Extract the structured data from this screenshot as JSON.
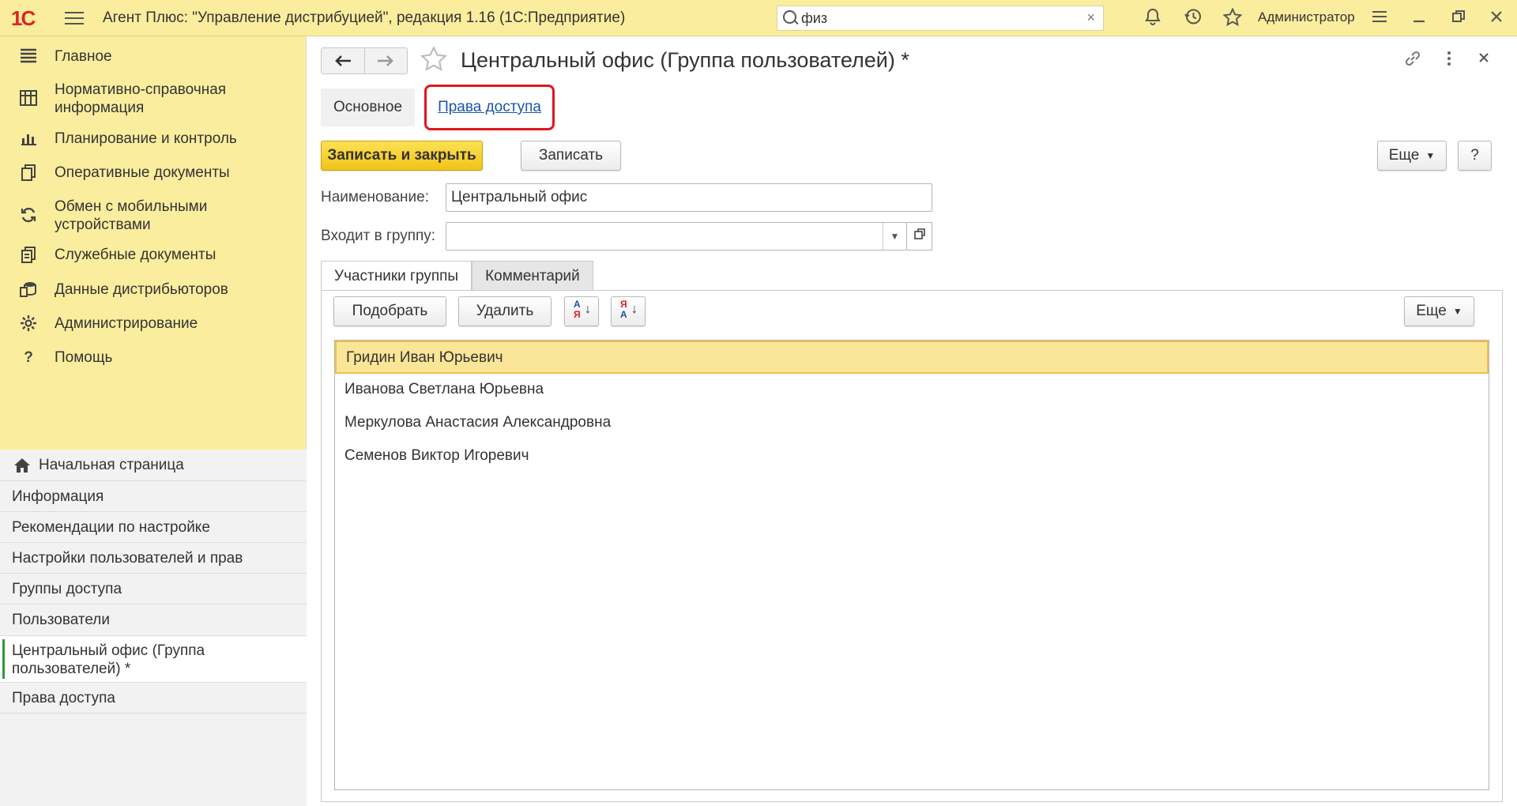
{
  "app": {
    "logo_text": "1С",
    "title": "Агент Плюс: \"Управление дистрибуцией\", редакция 1.16  (1С:Предприятие)",
    "search_value": "физ",
    "search_clear": "×",
    "user": "Администратор",
    "icons": [
      "bell-icon",
      "history-icon",
      "star-icon",
      "settings-icon",
      "minimize-icon",
      "restore-icon",
      "close-icon"
    ]
  },
  "sidebar": {
    "sections": [
      {
        "label": "Главное",
        "icon": "menu-list-icon"
      },
      {
        "label": "Нормативно-справочная информация",
        "icon": "catalog-icon"
      },
      {
        "label": "Планирование и контроль",
        "icon": "chart-icon"
      },
      {
        "label": "Оперативные документы",
        "icon": "documents-icon"
      },
      {
        "label": "Обмен с мобильными устройствами",
        "icon": "sync-icon"
      },
      {
        "label": "Служебные документы",
        "icon": "service-docs-icon"
      },
      {
        "label": "Данные дистрибьюторов",
        "icon": "distributor-data-icon"
      },
      {
        "label": "Администрирование",
        "icon": "gear-icon"
      },
      {
        "label": "Помощь",
        "icon": "help-icon"
      }
    ],
    "open_windows": [
      {
        "label": "Начальная страница"
      },
      {
        "label": "Информация"
      },
      {
        "label": "Рекомендации по настройке"
      },
      {
        "label": "Настройки пользователей и прав"
      },
      {
        "label": "Группы доступа"
      },
      {
        "label": "Пользователи"
      },
      {
        "label": "Центральный офис (Группа пользователей) *"
      },
      {
        "label": "Права доступа"
      }
    ]
  },
  "form": {
    "title": "Центральный офис (Группа пользователей) *",
    "page_tabs": {
      "main": "Основное",
      "link": "Права доступа"
    },
    "buttons": {
      "save_close": "Записать и закрыть",
      "save": "Записать",
      "more": "Еще",
      "help": "?"
    },
    "fields": {
      "name_label": "Наименование:",
      "name_value": "Центральный офис",
      "parent_label": "Входит в группу:",
      "parent_value": ""
    },
    "tabs": [
      "Участники группы",
      "Комментарий"
    ],
    "members_toolbar": {
      "pick": "Подобрать",
      "delete": "Удалить",
      "sort_asc_top": "А",
      "sort_asc_bottom": "Я",
      "sort_desc_top": "Я",
      "sort_desc_bottom": "А",
      "more": "Еще"
    },
    "members": [
      "Гридин Иван Юрьевич",
      "Иванова Светлана Юрьевна",
      "Меркулова Анастасия Александровна",
      "Семенов Виктор Игоревич"
    ],
    "selected_index": 0
  },
  "colors": {
    "panel_yellow": "#fbed9e",
    "accent_yellow": "#f2c318",
    "highlight_red": "#e0151e",
    "link_blue": "#1b54a8",
    "active_green": "#2e9b3b",
    "selection": "#fbe597"
  }
}
